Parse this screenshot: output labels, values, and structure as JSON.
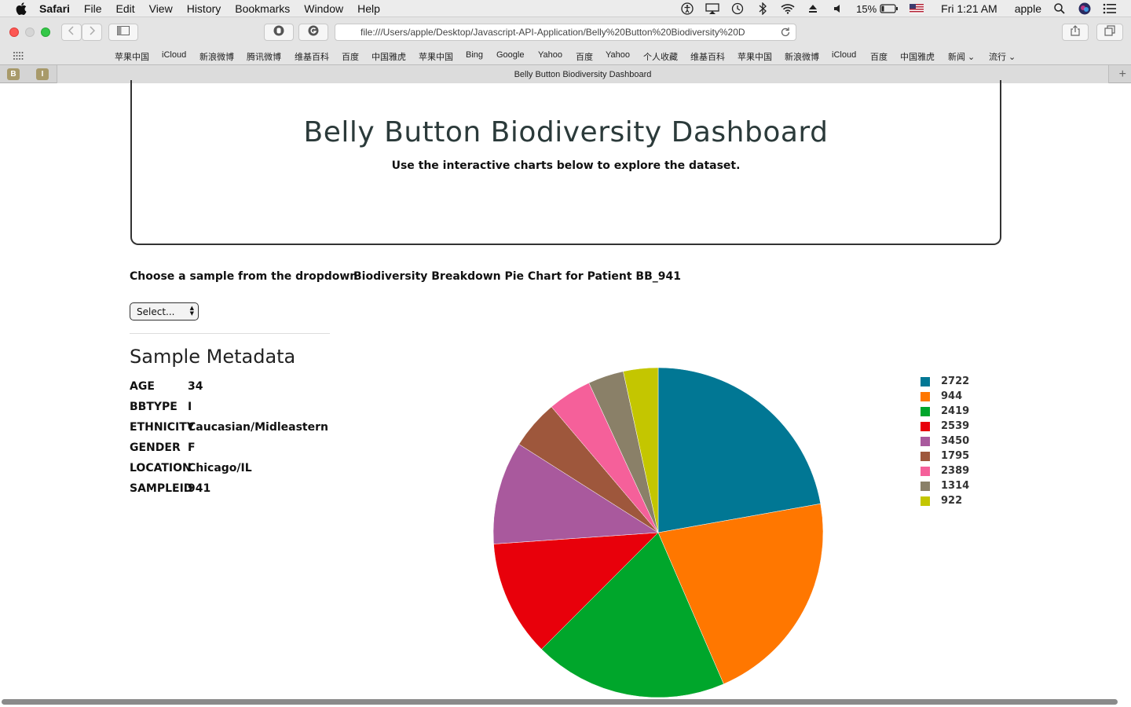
{
  "menubar": {
    "app_name": "Safari",
    "items": [
      "File",
      "Edit",
      "View",
      "History",
      "Bookmarks",
      "Window",
      "Help"
    ],
    "battery": "15%",
    "clock": "Fri 1:21 AM",
    "user": "apple"
  },
  "toolbar": {
    "url": "file:///Users/apple/Desktop/Javascript-API-Application/Belly%20Button%20Biodiversity%20D"
  },
  "bookmarks": [
    "苹果中国",
    "iCloud",
    "新浪微博",
    "腾讯微博",
    "维基百科",
    "百度",
    "中国雅虎",
    "苹果中国",
    "Bing",
    "Google",
    "Yahoo",
    "百度",
    "Yahoo",
    "个人收藏",
    "维基百科",
    "苹果中国",
    "新浪微博",
    "iCloud",
    "百度",
    "中国雅虎",
    "新闻 ⌄",
    "流行 ⌄"
  ],
  "tabs": {
    "pinned": [
      "B",
      "I"
    ],
    "active_title": "Belly Button Biodiversity Dashboard"
  },
  "page": {
    "title": "Belly Button Biodiversity Dashboard",
    "subtitle": "Use the interactive charts below to explore the dataset.",
    "dropdown_label": "Choose a sample from the dropdown",
    "select_value": "Select...",
    "metadata_title": "Sample Metadata",
    "metadata": [
      {
        "key": "AGE",
        "value": "34"
      },
      {
        "key": "BBTYPE",
        "value": "I"
      },
      {
        "key": "ETHNICITY",
        "value": "Caucasian/Midleastern"
      },
      {
        "key": "GENDER",
        "value": "F"
      },
      {
        "key": "LOCATION",
        "value": "Chicago/IL"
      },
      {
        "key": "SAMPLEID",
        "value": "941"
      }
    ],
    "chart_title": "Biodiversity Breakdown Pie Chart for Patient BB_941"
  },
  "chart_data": {
    "type": "pie",
    "title": "Biodiversity Breakdown Pie Chart for Patient BB_941",
    "labels": [
      "2722",
      "944",
      "2419",
      "2539",
      "3450",
      "1795",
      "2389",
      "1314",
      "922"
    ],
    "values": [
      22.2,
      21.3,
      19.0,
      11.4,
      10.1,
      4.8,
      4.3,
      3.5,
      3.4
    ],
    "colors": [
      "#017794",
      "#ff7700",
      "#00a62b",
      "#e8000b",
      "#a9599d",
      "#9e573c",
      "#f5609a",
      "#8a8068",
      "#c4c600"
    ],
    "legend_position": "right"
  }
}
